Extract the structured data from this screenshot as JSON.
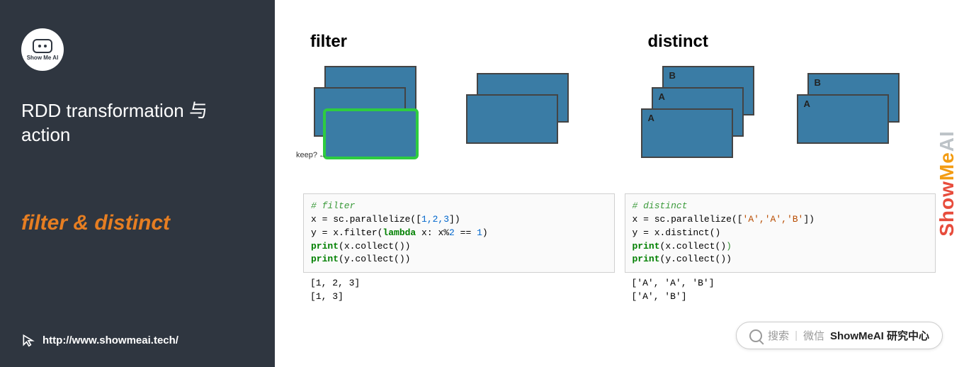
{
  "sidebar": {
    "logo_text": "Show Me AI",
    "title": "RDD transformation 与action",
    "subtitle_filter": "filter",
    "subtitle_amp": " & ",
    "subtitle_distinct": "distinct",
    "url": "http://www.showmeai.tech/"
  },
  "diagram": {
    "filter": {
      "title": "filter",
      "keep_label": "keep?",
      "input_labels": [
        "",
        "",
        ""
      ],
      "output_labels": [
        "",
        ""
      ]
    },
    "distinct": {
      "title": "distinct",
      "input_labels": [
        "B",
        "A",
        "A"
      ],
      "output_labels": [
        "B",
        "A"
      ]
    }
  },
  "code": {
    "filter": {
      "comment": "# filter",
      "line1a": "x = sc.parallelize([",
      "line1_nums": "1,2,3",
      "line1b": "])",
      "line2a": "y = x.filter(",
      "line2_kw": "lambda",
      "line2b": " x: x%",
      "line2_n": "2",
      "line2c": " == ",
      "line2_n2": "1",
      "line2d": ")",
      "line3_kw": "print",
      "line3a": "(x.collect())",
      "line4_kw": "print",
      "line4a": "(y.collect())",
      "output": "[1, 2, 3]\n[1, 3]"
    },
    "distinct": {
      "comment": "# distinct",
      "line1a": "x = sc.parallelize([",
      "line1_strs": "'A','A','B'",
      "line1b": "])",
      "line2": "y = x.distinct()",
      "line3_kw": "print",
      "line3a": "(x.collect()",
      "line3b": ")",
      "line4_kw": "print",
      "line4a": "(y.collect())",
      "output": "['A', 'A', 'B']\n['A', 'B']"
    }
  },
  "watermark": {
    "p1": "Show",
    "p2": "Me",
    "p3": "AI"
  },
  "search": {
    "label": "搜索",
    "channel": "微信",
    "brand": "ShowMeAI 研究中心"
  }
}
